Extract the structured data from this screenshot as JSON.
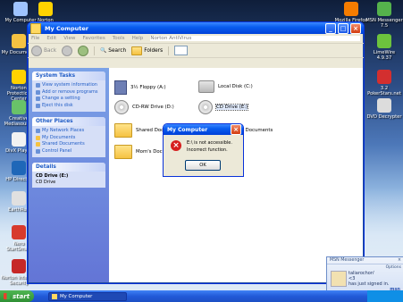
{
  "desktop": {
    "icons_left": [
      {
        "label": "My Computer"
      },
      {
        "label": "My Documents"
      },
      {
        "label": "Norton Protection Center"
      },
      {
        "label": "Creative Mediasource"
      },
      {
        "label": "DivX Player"
      },
      {
        "label": "HP Director"
      },
      {
        "label": "EarthRun"
      },
      {
        "label": "Nero StartSmart"
      },
      {
        "label": "Norton Internet Security"
      }
    ],
    "icons_top": [
      {
        "label": "Norton"
      }
    ],
    "icons_right": [
      {
        "label": "Mozilla Firefox"
      },
      {
        "label": "MSN Messenger 7.5"
      },
      {
        "label": "LimeWire 4.9.37"
      },
      {
        "label": "3.2 PokerStars.net"
      },
      {
        "label": "DVD Decrypter"
      }
    ]
  },
  "explorer": {
    "title": "My Computer",
    "menu": [
      "File",
      "Edit",
      "View",
      "Favorites",
      "Tools",
      "Help"
    ],
    "menu_right": "Norton AntiVirus",
    "toolbar": {
      "back": "Back",
      "search": "Search",
      "folders": "Folders"
    },
    "system_tasks": {
      "title": "System Tasks",
      "items": [
        "View system information",
        "Add or remove programs",
        "Change a setting",
        "Eject this disk"
      ]
    },
    "other_places": {
      "title": "Other Places",
      "items": [
        "My Network Places",
        "My Documents",
        "Shared Documents",
        "Control Panel"
      ]
    },
    "details": {
      "title": "Details",
      "name": "CD Drive (E:)",
      "type": "CD Drive"
    },
    "items": [
      {
        "label": "3½ Floppy (A:)"
      },
      {
        "label": "Local Disk (C:)"
      },
      {
        "label": "CD-RW Drive (D:)"
      },
      {
        "label": "CD Drive (E:)"
      },
      {
        "label": "Shared Documents"
      },
      {
        "label": "Anthony's Documents"
      },
      {
        "label": "Mom's Documents"
      }
    ]
  },
  "dialog": {
    "title": "My Computer",
    "line1": "E:\\ is not accessible.",
    "line2": "Incorrect function.",
    "ok": "OK"
  },
  "msn": {
    "header": "MSN Messenger",
    "options": "Options",
    "user": "taliarochon'",
    "sub": "<3",
    "status": "has just signed in.",
    "logo": "msn"
  },
  "taskbar": {
    "start": "start",
    "task": "My Computer"
  }
}
